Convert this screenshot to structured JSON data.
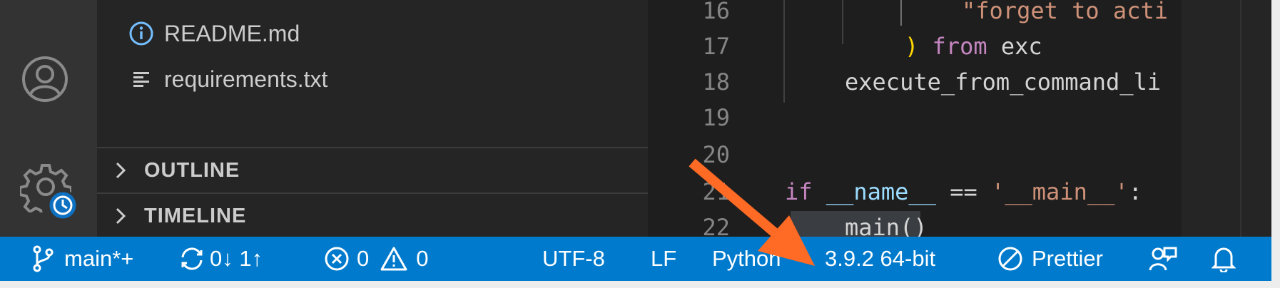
{
  "explorer": {
    "files": [
      {
        "name": "README.md",
        "icon": "info-icon"
      },
      {
        "name": "requirements.txt",
        "icon": "text-lines-icon"
      }
    ],
    "sections": [
      {
        "label": "OUTLINE"
      },
      {
        "label": "TIMELINE"
      }
    ]
  },
  "editor": {
    "lines": [
      {
        "number": "16",
        "text": "\"forget to acti"
      },
      {
        "number": "17",
        "paren": ")",
        "keyword": "from",
        "rest": " exc"
      },
      {
        "number": "18",
        "text": "execute_from_command_li"
      },
      {
        "number": "19",
        "text": ""
      },
      {
        "number": "20",
        "text": ""
      },
      {
        "number": "21",
        "kw": "if",
        "var": "__name__",
        "op": " == ",
        "str": "'__main__'",
        "tail": ":"
      },
      {
        "number": "22",
        "text": "main()"
      }
    ]
  },
  "statusbar": {
    "branch": "main*+",
    "sync": "0↓ 1↑",
    "errors": "0",
    "warnings": "0",
    "encoding": "UTF-8",
    "eol": "LF",
    "language": "Python",
    "interpreter": "3.9.2 64-bit",
    "formatter": "Prettier"
  },
  "colors": {
    "statusbar": "#007acc",
    "annotation_arrow": "#ff6a24"
  }
}
